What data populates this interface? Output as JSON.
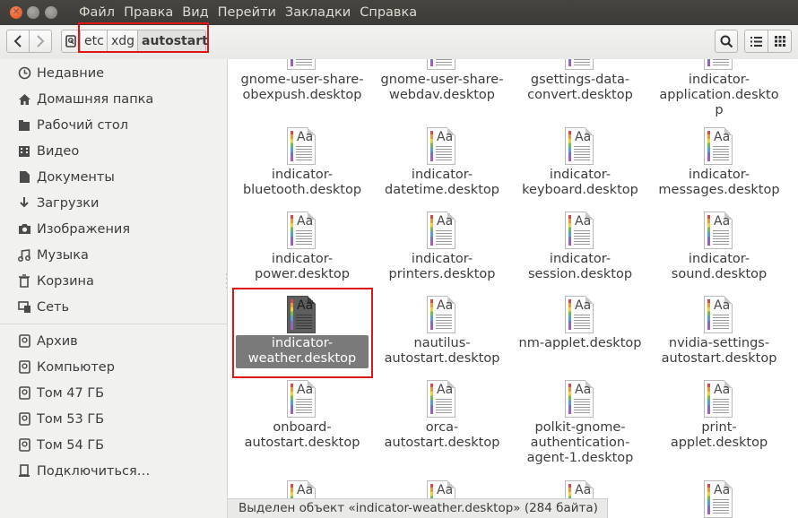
{
  "window": {
    "buttons": {
      "close": "✕",
      "minimize": "–",
      "maximize": "+"
    },
    "menu": [
      "Файл",
      "Правка",
      "Вид",
      "Перейти",
      "Закладки",
      "Справка"
    ]
  },
  "toolbar": {
    "breadcrumbs": [
      "etc",
      "xdg",
      "autostart"
    ],
    "current": "autostart"
  },
  "sidebar": {
    "places": [
      {
        "label": "Недавние",
        "icon": "clock-icon"
      },
      {
        "label": "Домашняя папка",
        "icon": "home-icon"
      },
      {
        "label": "Рабочий стол",
        "icon": "folder-icon"
      },
      {
        "label": "Видео",
        "icon": "video-icon"
      },
      {
        "label": "Документы",
        "icon": "document-icon"
      },
      {
        "label": "Загрузки",
        "icon": "download-icon"
      },
      {
        "label": "Изображения",
        "icon": "camera-icon"
      },
      {
        "label": "Музыка",
        "icon": "music-icon"
      },
      {
        "label": "Корзина",
        "icon": "trash-icon"
      },
      {
        "label": "Сеть",
        "icon": "network-icon"
      }
    ],
    "devices": [
      {
        "label": "Архив",
        "icon": "drive-icon"
      },
      {
        "label": "Компьютер",
        "icon": "drive-icon"
      },
      {
        "label": "Том 47 ГБ",
        "icon": "drive-icon"
      },
      {
        "label": "Том 53 ГБ",
        "icon": "drive-icon"
      },
      {
        "label": "Том 54 ГБ",
        "icon": "drive-icon"
      },
      {
        "label": "Подключиться…",
        "icon": "server-icon"
      }
    ]
  },
  "files": [
    {
      "name": "gnome-user-share-obexpush.desktop"
    },
    {
      "name": "gnome-user-share-webdav.desktop"
    },
    {
      "name": "gsettings-data-convert.desktop"
    },
    {
      "name": "indicator-application.desktop"
    },
    {
      "name": "indicator-bluetooth.desktop"
    },
    {
      "name": "indicator-datetime.desktop"
    },
    {
      "name": "indicator-keyboard.desktop"
    },
    {
      "name": "indicator-messages.desktop"
    },
    {
      "name": "indicator-power.desktop"
    },
    {
      "name": "indicator-printers.desktop"
    },
    {
      "name": "indicator-session.desktop"
    },
    {
      "name": "indicator-sound.desktop"
    },
    {
      "name": "indicator-weather.desktop",
      "selected": true
    },
    {
      "name": "nautilus-autostart.desktop"
    },
    {
      "name": "nm-applet.desktop"
    },
    {
      "name": "nvidia-settings-autostart.desktop"
    },
    {
      "name": "onboard-autostart.desktop"
    },
    {
      "name": "orca-autostart.desktop"
    },
    {
      "name": "polkit-gnome-authentication-agent-1.desktop"
    },
    {
      "name": "print-applet.desktop"
    }
  ],
  "statusbar": {
    "text": "Выделен объект «indicator-weather.desktop»  (284 байта)"
  }
}
